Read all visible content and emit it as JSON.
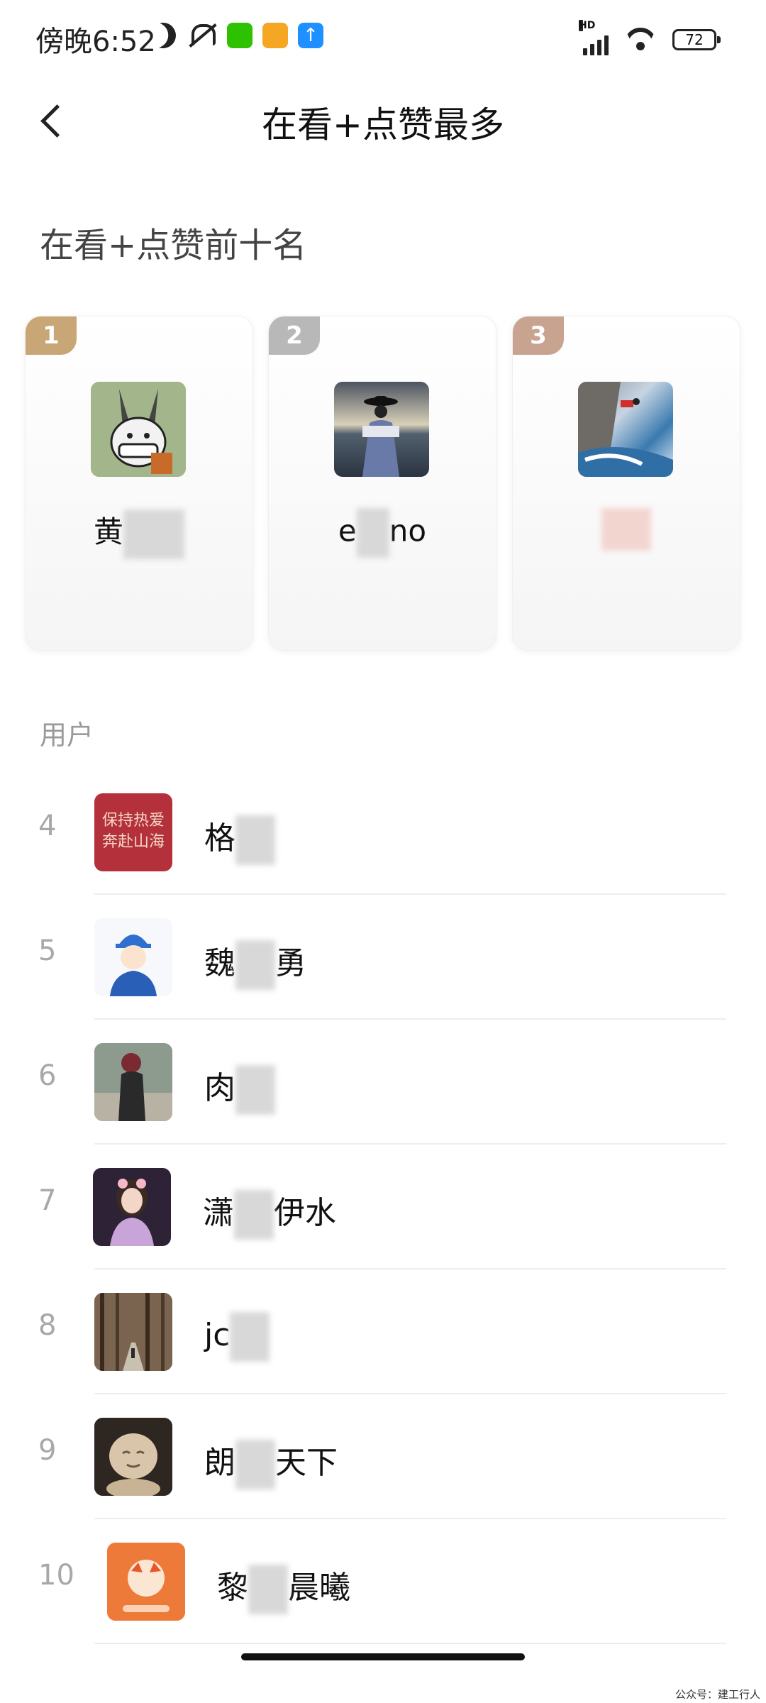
{
  "status_bar": {
    "time": "傍晚6:52",
    "network": "HD",
    "battery": "72",
    "icons": [
      "moon-icon",
      "bell-off-icon",
      "wechat-app-icon",
      "orange-app-icon",
      "blue-upload-app-icon",
      "signal-icon",
      "wifi-icon",
      "battery-icon"
    ]
  },
  "header": {
    "title": "在看+点赞最多",
    "back_icon": "chevron-left-icon"
  },
  "top_section": {
    "title": "在看+点赞前十名",
    "cards": [
      {
        "rank": "1",
        "name_visible": "黄"
      },
      {
        "rank": "2",
        "name_visible_start": "e",
        "name_visible_end": "no"
      },
      {
        "rank": "3",
        "name_visible": ""
      }
    ]
  },
  "users": {
    "label": "用户",
    "items": [
      {
        "rank": "4",
        "name_start": "格",
        "name_end": "",
        "avatar_text": "保持热爱\n奔赴山海"
      },
      {
        "rank": "5",
        "name_start": "魏",
        "name_end": "勇"
      },
      {
        "rank": "6",
        "name_start": "肉",
        "name_end": ""
      },
      {
        "rank": "7",
        "name_start": "潇",
        "name_end": "伊水"
      },
      {
        "rank": "8",
        "name_start": "jc",
        "name_end": ""
      },
      {
        "rank": "9",
        "name_start": "朗",
        "name_end": "天下"
      },
      {
        "rank": "10",
        "name_start": "黎",
        "name_end": "晨曦"
      }
    ]
  },
  "watermark": "公众号：建工行人",
  "colors": {
    "gold": "#c8a676",
    "silver": "#b8b8b8",
    "bronze": "#c7a390",
    "rank_text": "#a8a8a8"
  }
}
